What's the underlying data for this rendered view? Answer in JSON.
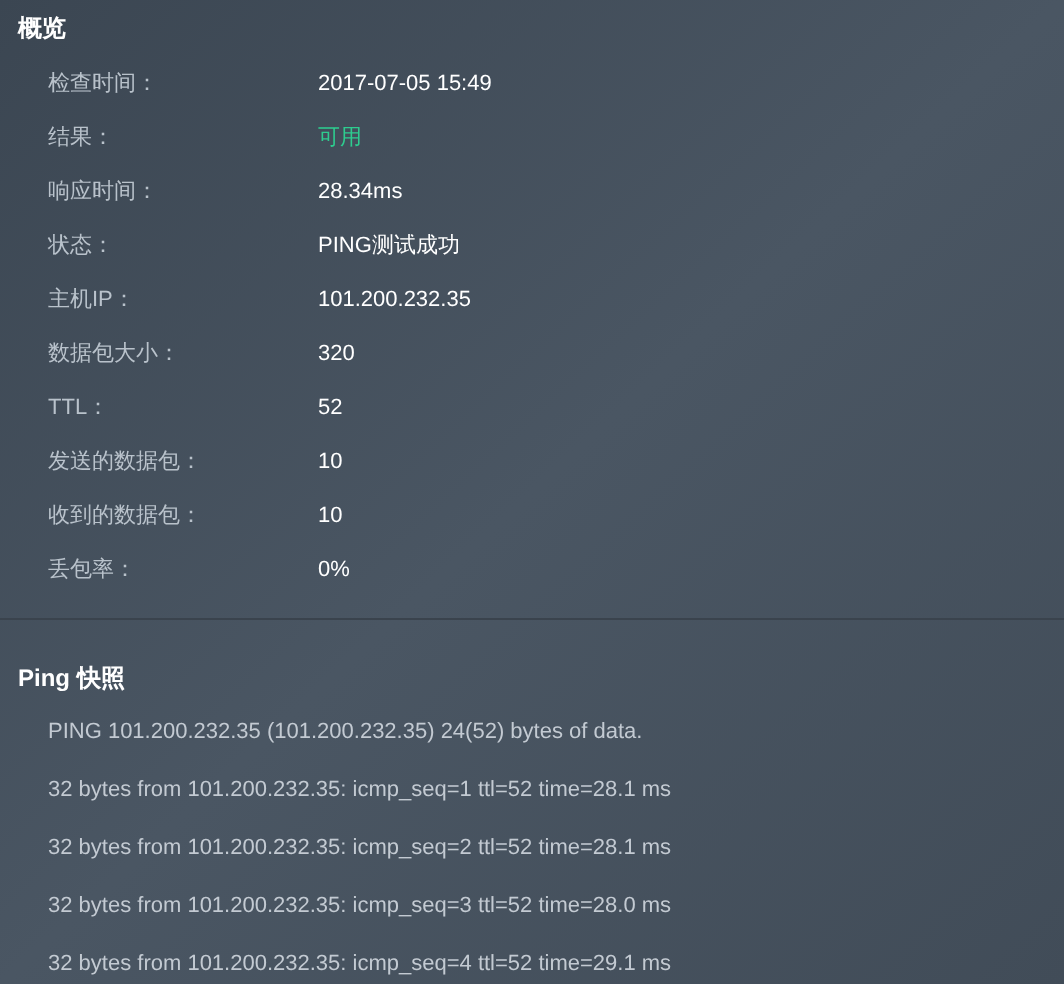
{
  "overview": {
    "title": "概览",
    "rows": [
      {
        "label": "检查时间：",
        "value": "2017-07-05 15:49",
        "kind": "text"
      },
      {
        "label": "结果：",
        "value": "可用",
        "kind": "status"
      },
      {
        "label": "响应时间：",
        "value": "28.34ms",
        "kind": "text"
      },
      {
        "label": "状态：",
        "value": "PING测试成功",
        "kind": "text"
      },
      {
        "label": "主机IP：",
        "value": "101.200.232.35",
        "kind": "text"
      },
      {
        "label": "数据包大小：",
        "value": "320",
        "kind": "text"
      },
      {
        "label": "TTL：",
        "value": "52",
        "kind": "text"
      },
      {
        "label": "发送的数据包：",
        "value": "10",
        "kind": "text"
      },
      {
        "label": "收到的数据包：",
        "value": "10",
        "kind": "text"
      },
      {
        "label": "丢包率：",
        "value": "0%",
        "kind": "text"
      }
    ]
  },
  "snapshot": {
    "title": "Ping 快照",
    "lines": [
      "PING 101.200.232.35 (101.200.232.35) 24(52) bytes of data.",
      "32 bytes from 101.200.232.35: icmp_seq=1 ttl=52 time=28.1 ms",
      "32 bytes from 101.200.232.35: icmp_seq=2 ttl=52 time=28.1 ms",
      "32 bytes from 101.200.232.35: icmp_seq=3 ttl=52 time=28.0 ms",
      "32 bytes from 101.200.232.35: icmp_seq=4 ttl=52 time=29.1 ms"
    ]
  }
}
